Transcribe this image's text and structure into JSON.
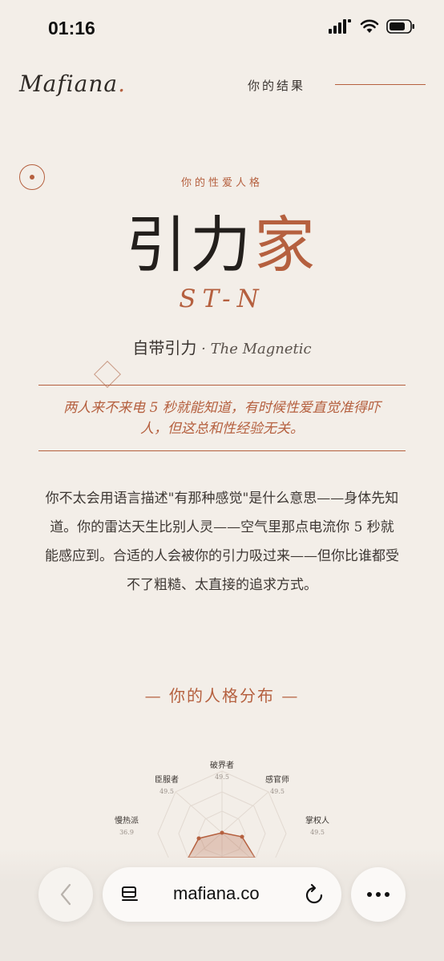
{
  "status_bar": {
    "time": "01:16"
  },
  "header": {
    "logo": "Mafiana",
    "logo_dot": ".",
    "nav_label": "你的结果"
  },
  "result": {
    "eyebrow": "你的性爱人格",
    "title_main": "引力",
    "title_accent": "家",
    "code": "ST-N",
    "tagline_cn": "自带引力",
    "tagline_sep": " · ",
    "tagline_en": "The Magnetic",
    "quote": "两人来不来电 5 秒就能知道，有时候性爱直觉准得吓人，但这总和性经验无关。",
    "description": "你不太会用语言描述\"有那种感觉\"是什么意思——身体先知道。你的雷达天生比别人灵——空气里那点电流你 5 秒就能感应到。合适的人会被你的引力吸过来——但你比谁都受不了粗糙、太直接的追求方式。"
  },
  "distribution": {
    "title": "— 你的人格分布 —",
    "labels": [
      {
        "name": "破界者",
        "value": "49.5"
      },
      {
        "name": "感官师",
        "value": "49.5"
      },
      {
        "name": "掌权人",
        "value": "49.5"
      },
      {
        "name": "臣服者",
        "value": "49.5"
      },
      {
        "name": "慢热派",
        "value": "36.9"
      }
    ]
  },
  "browser": {
    "url": "mafiana.co"
  },
  "colors": {
    "accent": "#b5603f",
    "background": "#f3eee8",
    "text": "#2b2622"
  }
}
